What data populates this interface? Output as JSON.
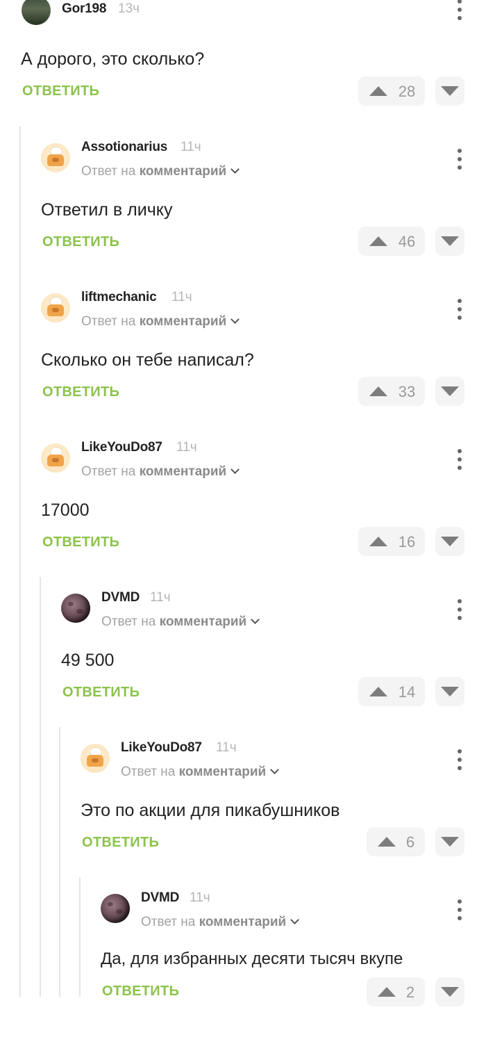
{
  "colors": {
    "accent": "#8bc34a",
    "text": "#222222",
    "muted": "#a3a3a3",
    "thread_line": "#e6e6e6"
  },
  "comments": [
    {
      "author": "Gor198",
      "time": "13ч",
      "text": "А дорого, это сколько?",
      "reply_label": "ОТВЕТИТЬ",
      "votes": "28",
      "avatar": "landscape-photo"
    },
    {
      "author": "Assotionarius",
      "time": "11ч",
      "reply_to_prefix": "Ответ на",
      "reply_to_target": "комментарий",
      "text": "Ответил в личку",
      "reply_label": "ОТВЕТИТЬ",
      "votes": "46",
      "avatar": "cook-mascot"
    },
    {
      "author": "liftmechanic",
      "time": "11ч",
      "reply_to_prefix": "Ответ на",
      "reply_to_target": "комментарий",
      "text": "Сколько он тебе написал?",
      "reply_label": "ОТВЕТИТЬ",
      "votes": "33",
      "avatar": "cook-mascot"
    },
    {
      "author": "LikeYouDo87",
      "time": "11ч",
      "reply_to_prefix": "Ответ на",
      "reply_to_target": "комментарий",
      "text": "17000",
      "reply_label": "ОТВЕТИТЬ",
      "votes": "16",
      "avatar": "cook-mascot"
    },
    {
      "author": "DVMD",
      "time": "11ч",
      "reply_to_prefix": "Ответ на",
      "reply_to_target": "комментарий",
      "text": "49 500",
      "reply_label": "ОТВЕТИТЬ",
      "votes": "14",
      "avatar": "moon"
    },
    {
      "author": "LikeYouDo87",
      "time": "11ч",
      "reply_to_prefix": "Ответ на",
      "reply_to_target": "комментарий",
      "text": "Это по акции для пикабушников",
      "reply_label": "ОТВЕТИТЬ",
      "votes": "6",
      "avatar": "cook-mascot"
    },
    {
      "author": "DVMD",
      "time": "11ч",
      "reply_to_prefix": "Ответ на",
      "reply_to_target": "комментарий",
      "text": "Да, для избранных десяти тысяч вкупе",
      "reply_label": "ОТВЕТИТЬ",
      "votes": "2",
      "avatar": "moon"
    }
  ]
}
